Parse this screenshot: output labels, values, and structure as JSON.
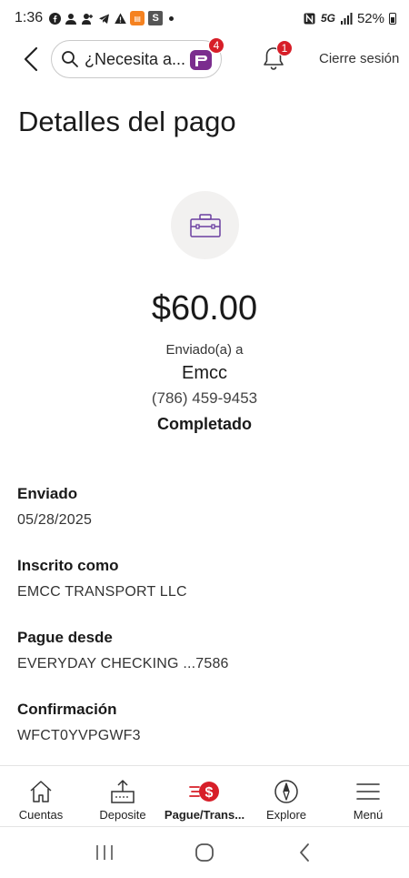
{
  "status_bar": {
    "time": "1:36",
    "network": "5G",
    "battery": "52%"
  },
  "header": {
    "search_placeholder": "¿Necesita a...",
    "assistant_badge": "4",
    "notification_badge": "1",
    "logout_label": "Cierre sesión"
  },
  "page": {
    "title": "Detalles del pago"
  },
  "payment": {
    "amount": "$60.00",
    "sent_to_label": "Enviado(a) a",
    "recipient": "Emcc",
    "phone": "(786) 459-9453",
    "status": "Completado"
  },
  "details": [
    {
      "label": "Enviado",
      "value": "05/28/2025"
    },
    {
      "label": "Inscrito como",
      "value": "EMCC TRANSPORT LLC"
    },
    {
      "label": "Pague desde",
      "value": "EVERYDAY CHECKING ...7586"
    },
    {
      "label": "Confirmación",
      "value": "WFCT0YVPGWF3"
    }
  ],
  "bottom_nav": {
    "items": [
      {
        "label": "Cuentas",
        "icon": "home-icon"
      },
      {
        "label": "Deposite",
        "icon": "deposit-icon"
      },
      {
        "label": "Pague/Trans...",
        "icon": "pay-transfer-icon"
      },
      {
        "label": "Explore",
        "icon": "compass-icon"
      },
      {
        "label": "Menú",
        "icon": "hamburger-menu-icon"
      }
    ]
  },
  "colors": {
    "brand_red": "#d71e28",
    "icon_purple": "#6b3fa0",
    "assistant_purple": "#7b2d8e"
  }
}
